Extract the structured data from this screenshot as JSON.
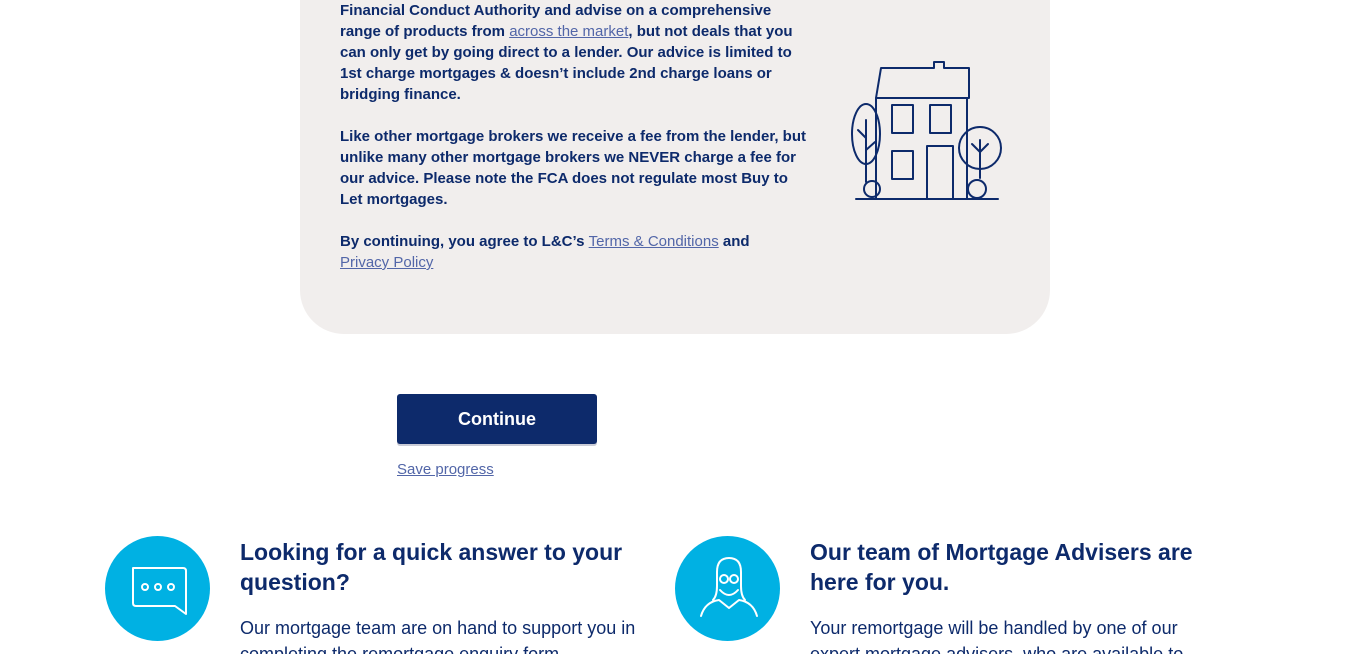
{
  "info": {
    "p1_line1": "Financial Conduct Authority and advise on a comprehensive range of products from ",
    "p1_link": "across the market",
    "p1_rest": ", but not deals that you can only get by going direct to a lender. Our advice is limited to 1st charge mortgages & doesn’t include 2nd charge loans or bridging finance.",
    "p2": "Like other mortgage brokers we receive a fee from the lender, but unlike many other mortgage brokers we NEVER charge a fee for our advice. Please note the FCA does not regulate most Buy to Let mortgages.",
    "p3_prefix": "By continuing, you agree to L&C’s ",
    "terms_link": "Terms & Conditions",
    "p3_and": " and ",
    "privacy_link": "Privacy Policy"
  },
  "actions": {
    "continue_label": "Continue",
    "save_label": "Save progress"
  },
  "help": {
    "left": {
      "icon": "chat-bubble-icon",
      "heading": "Looking for a quick answer to your question?",
      "body": "Our mortgage team are on hand to support you in completing the remortgage enquiry form."
    },
    "right": {
      "icon": "adviser-person-icon",
      "heading": "Our team of Mortgage Advisers are here for you.",
      "body": "Your remortgage will be handled by one of our expert mortgage advisers, who are available to"
    }
  },
  "colors": {
    "navy": "#0d2a6b",
    "link": "#5266a8",
    "accent": "#00b1e3",
    "card": "#f1eeed"
  }
}
